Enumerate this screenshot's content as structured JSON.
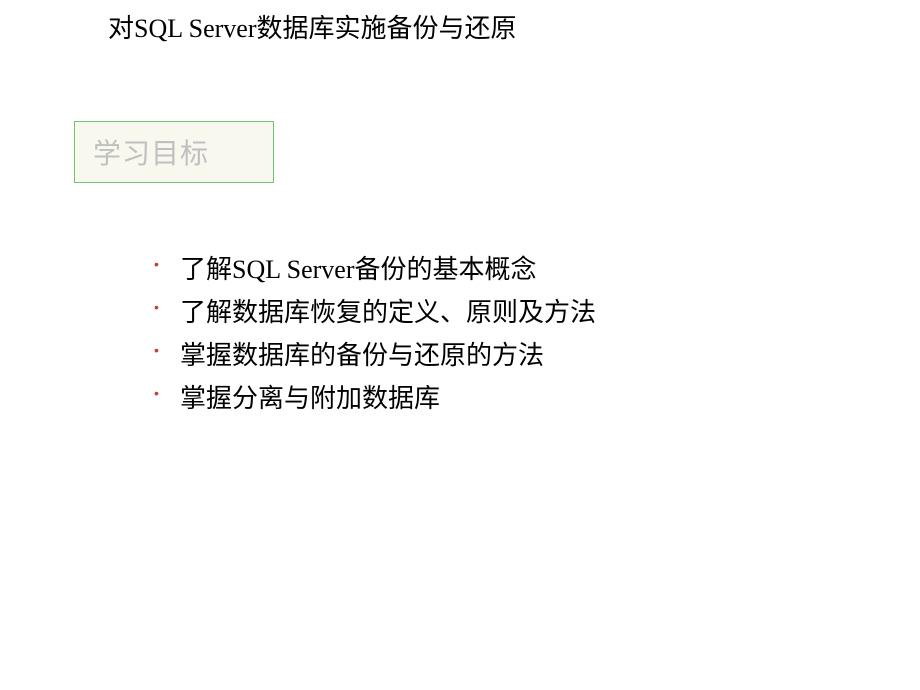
{
  "title": "对SQL Server数据库实施备份与还原",
  "objectives": {
    "label": "学习目标"
  },
  "bullets": [
    "了解SQL Server备份的基本概念",
    "了解数据库恢复的定义、原则及方法",
    "掌握数据库的备份与还原的方法",
    "掌握分离与附加数据库"
  ],
  "page_indicator": ""
}
